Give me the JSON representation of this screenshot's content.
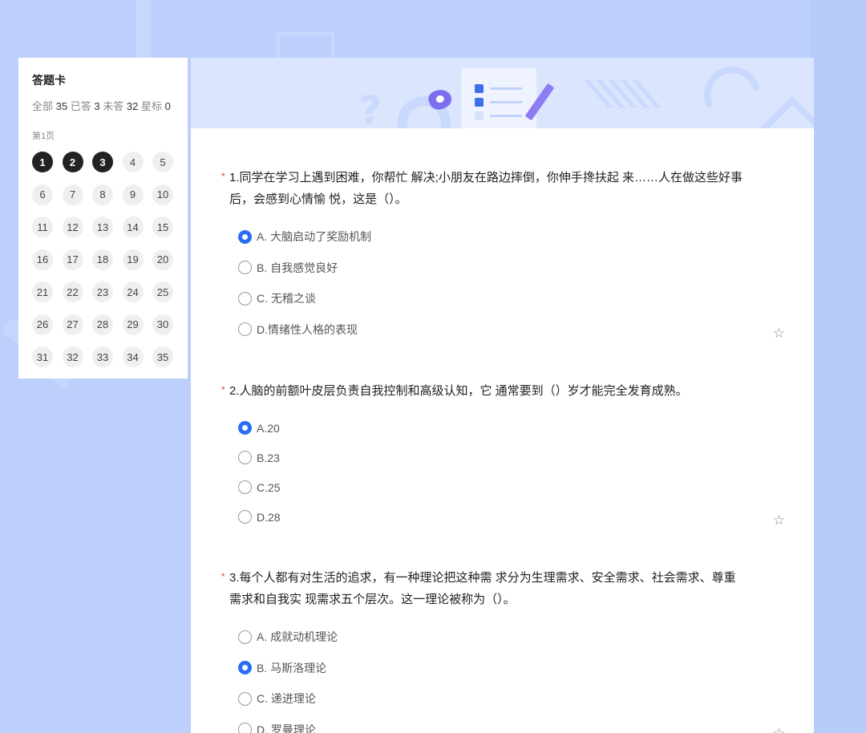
{
  "answer_card": {
    "title": "答题卡",
    "stats": {
      "total_label": "全部",
      "total": "35",
      "answered_label": "已答",
      "answered": "3",
      "unanswered_label": "未答",
      "unanswered": "32",
      "starred_label": "星标",
      "starred": "0"
    },
    "page_label": "第1页",
    "numbers": [
      "1",
      "2",
      "3",
      "4",
      "5",
      "6",
      "7",
      "8",
      "9",
      "10",
      "11",
      "12",
      "13",
      "14",
      "15",
      "16",
      "17",
      "18",
      "19",
      "20",
      "21",
      "22",
      "23",
      "24",
      "25",
      "26",
      "27",
      "28",
      "29",
      "30",
      "31",
      "32",
      "33",
      "34",
      "35"
    ],
    "answered_numbers": [
      "1",
      "2",
      "3"
    ]
  },
  "questions": [
    {
      "title": "1.同学在学习上遇到困难，你帮忙 解决;小朋友在路边摔倒，你伸手搀扶起 来……人在做这些好事后，会感到心情愉 悦，这是（）。",
      "required_mark": "*",
      "star_icon": "star-outline-icon",
      "options": [
        "A. 大脑启动了奖励机制",
        "B. 自我感觉良好",
        "C. 无稽之谈",
        "D.情绪性人格的表现"
      ],
      "selected": 0
    },
    {
      "title": "2.人脑的前额叶皮层负责自我控制和高级认知，它 通常要到（）岁才能完全发育成熟。",
      "required_mark": "*",
      "star_icon": "star-outline-icon",
      "options": [
        "A.20",
        "B.23",
        "C.25",
        "D.28"
      ],
      "selected": 0
    },
    {
      "title": "3.每个人都有对生活的追求，有一种理论把这种需 求分为生理需求、安全需求、社会需求、尊重需求和自我实 现需求五个层次。这一理论被称为（）。",
      "required_mark": "*",
      "star_icon": "star-outline-icon",
      "options": [
        "A. 成就动机理论",
        "B. 马斯洛理论",
        "C. 递进理论",
        "D. 罗曼理论"
      ],
      "selected": 1
    }
  ],
  "colors": {
    "background": "#bcd0fb",
    "accent": "#2b6df2",
    "required": "#e8432b",
    "answered_badge": "#222222"
  }
}
